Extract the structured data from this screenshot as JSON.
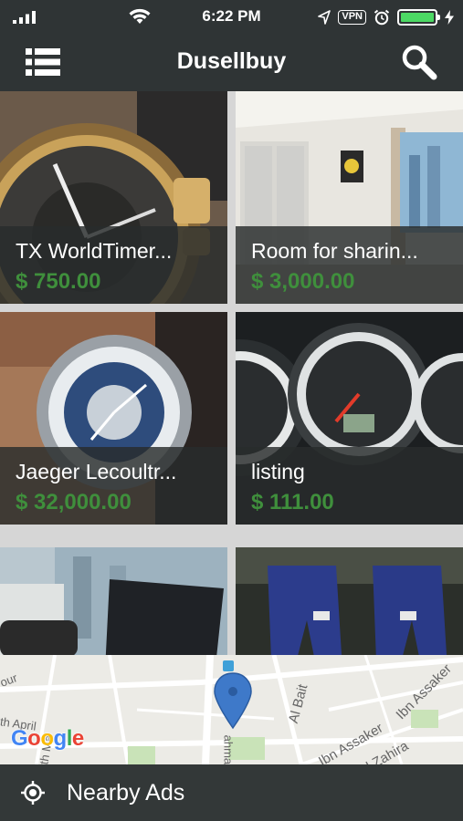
{
  "status_bar": {
    "time": "6:22 PM",
    "vpn_label": "VPN",
    "icons": [
      "signal-icon",
      "wifi-icon",
      "location-icon",
      "vpn-badge",
      "alarm-icon",
      "battery-icon",
      "charging-icon"
    ],
    "battery_color": "#4cd964"
  },
  "header": {
    "title": "Dusellbuy",
    "icons": [
      "menu-list-icon",
      "search-icon"
    ]
  },
  "listings": [
    {
      "title": "TX WorldTimer...",
      "price": "$ 750.00",
      "image": "gold watch photo"
    },
    {
      "title": "Room for sharin...",
      "price": "$ 3,000.00",
      "image": "empty room photo"
    },
    {
      "title": "Jaeger Lecoultr...",
      "price": "$ 32,000.00",
      "image": "world time watch on wrist photo"
    },
    {
      "title": "listing",
      "price": "$ 111.00",
      "image": "car dashboard photo"
    },
    {
      "title": "",
      "price": "",
      "image": "laptop by window photo"
    },
    {
      "title": "",
      "price": "",
      "image": "blue puma pants photo"
    }
  ],
  "map": {
    "labels": [
      "our",
      "th April",
      "6th Ma",
      "Al Bait",
      "Ibn Assaker",
      "Ibn Assaker",
      "Al Zahira",
      "ahman"
    ],
    "attribution": "Google",
    "pin_color": "#3e79c9"
  },
  "nearby": {
    "label": "Nearby Ads",
    "icon": "location-target-icon"
  },
  "colors": {
    "header_bg": "#2f3435",
    "price_green": "#3f8f3c",
    "overlay": "rgba(40,44,44,0.82)"
  }
}
